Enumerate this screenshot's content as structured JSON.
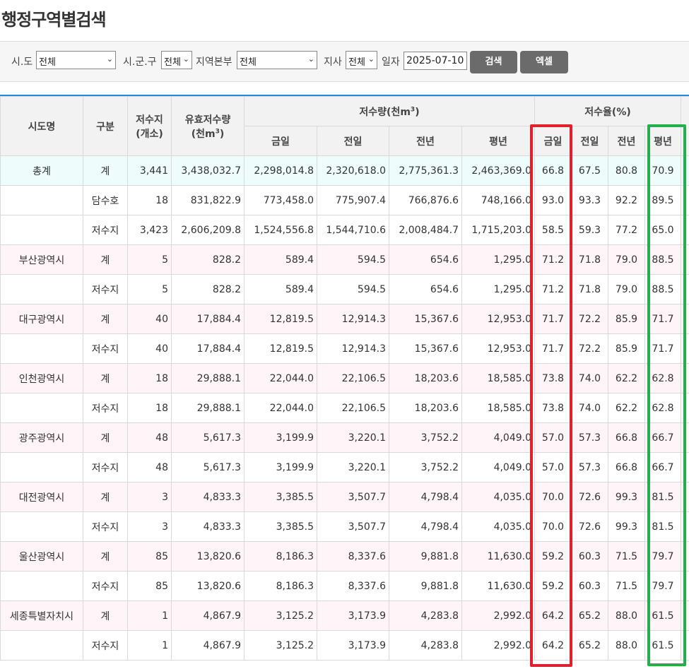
{
  "page": {
    "title": "행정구역별검색"
  },
  "filter": {
    "sido_label": "시.도",
    "sido_value": "전체",
    "sigungu_label": "시.군.구",
    "sigungu_value": "전체",
    "region_label": "지역본부",
    "region_value": "전체",
    "branch_label": "지사",
    "branch_value": "전체",
    "date_label": "일자",
    "date_value": "2025-07-10",
    "search_button": "검색",
    "excel_button": "엑셀"
  },
  "table": {
    "headers": {
      "sido": "시도명",
      "kind": "구분",
      "count_line1": "저수지",
      "count_line2": "(개소)",
      "capacity_line1": "유효저수량",
      "capacity_line2": "(천m",
      "capacity_sup": "3",
      "volume_group": "저수량(천m",
      "volume_sup": "3",
      "rate_group": "저수율(%)",
      "today": "금일",
      "yesterday": "전일",
      "last_year": "전년",
      "normal_year": "평년"
    },
    "rows": [
      {
        "sido": "총계",
        "kind": "계",
        "count": "3,441",
        "cap": "3,438,032.7",
        "v_today": "2,298,014.8",
        "v_yest": "2,320,618.0",
        "v_last": "2,775,361.3",
        "v_norm": "2,463,369.0",
        "r_today": "66.8",
        "r_yest": "67.5",
        "r_last": "80.8",
        "r_norm": "70.9"
      },
      {
        "sido": "",
        "kind": "담수호",
        "count": "18",
        "cap": "831,822.9",
        "v_today": "773,458.0",
        "v_yest": "775,907.4",
        "v_last": "766,876.6",
        "v_norm": "748,166.0",
        "r_today": "93.0",
        "r_yest": "93.3",
        "r_last": "92.2",
        "r_norm": "89.5"
      },
      {
        "sido": "",
        "kind": "저수지",
        "count": "3,423",
        "cap": "2,606,209.8",
        "v_today": "1,524,556.8",
        "v_yest": "1,544,710.6",
        "v_last": "2,008,484.7",
        "v_norm": "1,715,203.0",
        "r_today": "58.5",
        "r_yest": "59.3",
        "r_last": "77.2",
        "r_norm": "65.0"
      },
      {
        "sido": "부산광역시",
        "kind": "계",
        "count": "5",
        "cap": "828.2",
        "v_today": "589.4",
        "v_yest": "594.5",
        "v_last": "654.6",
        "v_norm": "1,295.0",
        "r_today": "71.2",
        "r_yest": "71.8",
        "r_last": "79.0",
        "r_norm": "88.5"
      },
      {
        "sido": "",
        "kind": "저수지",
        "count": "5",
        "cap": "828.2",
        "v_today": "589.4",
        "v_yest": "594.5",
        "v_last": "654.6",
        "v_norm": "1,295.0",
        "r_today": "71.2",
        "r_yest": "71.8",
        "r_last": "79.0",
        "r_norm": "88.5"
      },
      {
        "sido": "대구광역시",
        "kind": "계",
        "count": "40",
        "cap": "17,884.4",
        "v_today": "12,819.5",
        "v_yest": "12,914.3",
        "v_last": "15,367.6",
        "v_norm": "12,953.0",
        "r_today": "71.7",
        "r_yest": "72.2",
        "r_last": "85.9",
        "r_norm": "71.7"
      },
      {
        "sido": "",
        "kind": "저수지",
        "count": "40",
        "cap": "17,884.4",
        "v_today": "12,819.5",
        "v_yest": "12,914.3",
        "v_last": "15,367.6",
        "v_norm": "12,953.0",
        "r_today": "71.7",
        "r_yest": "72.2",
        "r_last": "85.9",
        "r_norm": "71.7"
      },
      {
        "sido": "인천광역시",
        "kind": "계",
        "count": "18",
        "cap": "29,888.1",
        "v_today": "22,044.0",
        "v_yest": "22,106.5",
        "v_last": "18,203.6",
        "v_norm": "18,585.0",
        "r_today": "73.8",
        "r_yest": "74.0",
        "r_last": "62.2",
        "r_norm": "62.8"
      },
      {
        "sido": "",
        "kind": "저수지",
        "count": "18",
        "cap": "29,888.1",
        "v_today": "22,044.0",
        "v_yest": "22,106.5",
        "v_last": "18,203.6",
        "v_norm": "18,585.0",
        "r_today": "73.8",
        "r_yest": "74.0",
        "r_last": "62.2",
        "r_norm": "62.8"
      },
      {
        "sido": "광주광역시",
        "kind": "계",
        "count": "48",
        "cap": "5,617.3",
        "v_today": "3,199.9",
        "v_yest": "3,220.1",
        "v_last": "3,752.2",
        "v_norm": "4,049.0",
        "r_today": "57.0",
        "r_yest": "57.3",
        "r_last": "66.8",
        "r_norm": "66.7"
      },
      {
        "sido": "",
        "kind": "저수지",
        "count": "48",
        "cap": "5,617.3",
        "v_today": "3,199.9",
        "v_yest": "3,220.1",
        "v_last": "3,752.2",
        "v_norm": "4,049.0",
        "r_today": "57.0",
        "r_yest": "57.3",
        "r_last": "66.8",
        "r_norm": "66.7"
      },
      {
        "sido": "대전광역시",
        "kind": "계",
        "count": "3",
        "cap": "4,833.3",
        "v_today": "3,385.5",
        "v_yest": "3,507.7",
        "v_last": "4,798.4",
        "v_norm": "4,035.0",
        "r_today": "70.0",
        "r_yest": "72.6",
        "r_last": "99.3",
        "r_norm": "81.5"
      },
      {
        "sido": "",
        "kind": "저수지",
        "count": "3",
        "cap": "4,833.3",
        "v_today": "3,385.5",
        "v_yest": "3,507.7",
        "v_last": "4,798.4",
        "v_norm": "4,035.0",
        "r_today": "70.0",
        "r_yest": "72.6",
        "r_last": "99.3",
        "r_norm": "81.5"
      },
      {
        "sido": "울산광역시",
        "kind": "계",
        "count": "85",
        "cap": "13,820.6",
        "v_today": "8,186.3",
        "v_yest": "8,337.6",
        "v_last": "9,881.8",
        "v_norm": "11,630.0",
        "r_today": "59.2",
        "r_yest": "60.3",
        "r_last": "71.5",
        "r_norm": "79.7"
      },
      {
        "sido": "",
        "kind": "저수지",
        "count": "85",
        "cap": "13,820.6",
        "v_today": "8,186.3",
        "v_yest": "8,337.6",
        "v_last": "9,881.8",
        "v_norm": "11,630.0",
        "r_today": "59.2",
        "r_yest": "60.3",
        "r_last": "71.5",
        "r_norm": "79.7"
      },
      {
        "sido": "세종특별자치시",
        "kind": "계",
        "count": "1",
        "cap": "4,867.9",
        "v_today": "3,125.2",
        "v_yest": "3,173.9",
        "v_last": "4,283.8",
        "v_norm": "2,992.0",
        "r_today": "64.2",
        "r_yest": "65.2",
        "r_last": "88.0",
        "r_norm": "61.5"
      },
      {
        "sido": "",
        "kind": "저수지",
        "count": "1",
        "cap": "4,867.9",
        "v_today": "3,125.2",
        "v_yest": "3,173.9",
        "v_last": "4,283.8",
        "v_norm": "2,992.0",
        "r_today": "64.2",
        "r_yest": "65.2",
        "r_last": "88.0",
        "r_norm": "61.5"
      }
    ]
  },
  "highlights": {
    "today_rate_color": "#e0202c",
    "normal_rate_color": "#21b04b"
  }
}
